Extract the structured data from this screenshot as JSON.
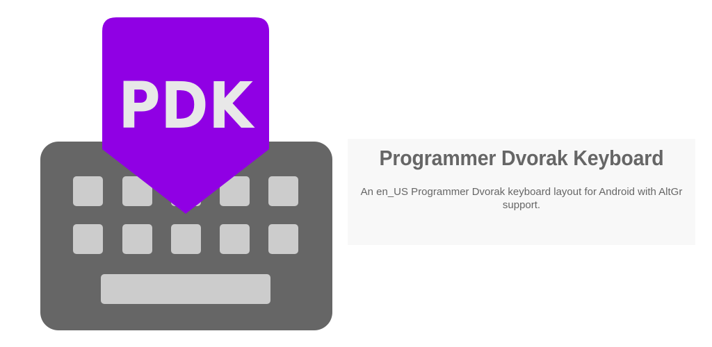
{
  "logo": {
    "text": "PDK",
    "banner_color": "#9000e4",
    "keyboard_color": "#666666",
    "key_color": "#cccccc",
    "text_color": "#e8e8e8"
  },
  "info": {
    "title": "Programmer Dvorak Keyboard",
    "description": "An en_US Programmer Dvorak keyboard layout for Android with AltGr support."
  }
}
